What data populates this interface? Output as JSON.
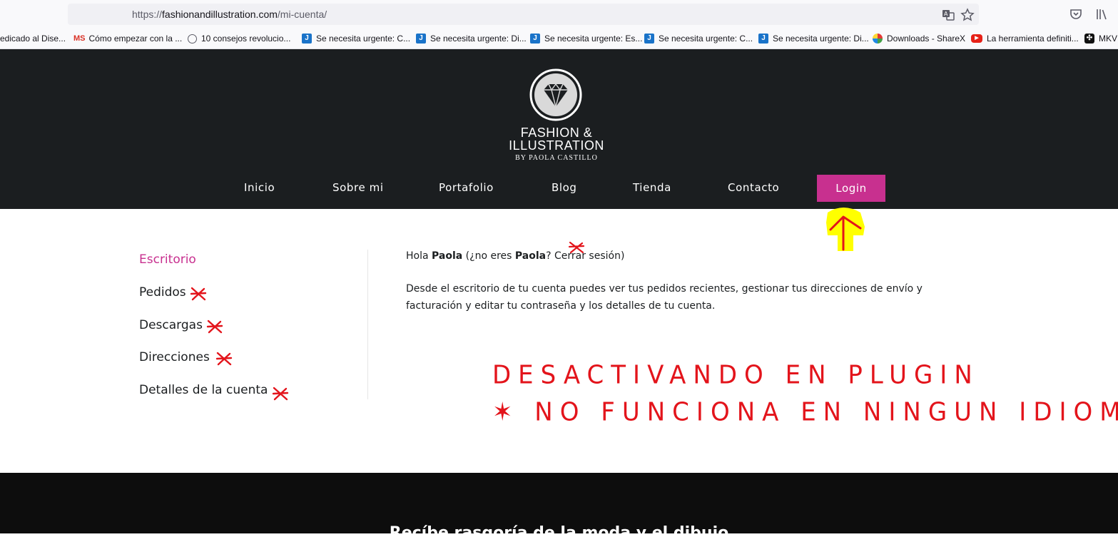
{
  "browser": {
    "url_scheme_prefix": "https://",
    "url_host": "fashionandillustration.com",
    "url_path": "/mi-cuenta/"
  },
  "bookmarks": [
    {
      "label": "edicado al Dise...",
      "icon": "none"
    },
    {
      "label": "Cómo empezar con la ...",
      "icon": "ms",
      "icon_text": "MS"
    },
    {
      "label": "10 consejos revolucio...",
      "icon": "globe"
    },
    {
      "label": "Se necesita urgente: C...",
      "icon": "j",
      "icon_text": "J"
    },
    {
      "label": "Se necesita urgente: Di...",
      "icon": "j",
      "icon_text": "J"
    },
    {
      "label": "Se necesita urgente: Es...",
      "icon": "j",
      "icon_text": "J"
    },
    {
      "label": "Se necesita urgente: C...",
      "icon": "j",
      "icon_text": "J"
    },
    {
      "label": "Se necesita urgente: Di...",
      "icon": "j",
      "icon_text": "J"
    },
    {
      "label": "Downloads - ShareX",
      "icon": "sharex"
    },
    {
      "label": "La herramienta definiti...",
      "icon": "youtube",
      "icon_text": "▶"
    },
    {
      "label": "MKV",
      "icon": "mkv",
      "icon_text": "✣"
    }
  ],
  "site": {
    "logo_line1": "FASHION &",
    "logo_line2": "ILLUSTRATION",
    "logo_sub": "BY PAOLA CASTILLO",
    "nav": [
      "Inicio",
      "Sobre mi",
      "Portafolio",
      "Blog",
      "Tienda",
      "Contacto"
    ],
    "login_label": "Login",
    "brand_color": "#c8308f",
    "header_color": "#1b1e20"
  },
  "account": {
    "nav": [
      "Escritorio",
      "Pedidos",
      "Descargas",
      "Direcciones",
      "Detalles de la cuenta"
    ],
    "greeting": {
      "hola": "Hola",
      "user": "Paola",
      "no_eres": "(¿no eres",
      "user2": "Paola",
      "q": "?",
      "logout": "Cerrar sesión",
      "close": ")"
    },
    "dashboard_text": "Desde el escritorio de tu cuenta puedes ver tus pedidos recientes, gestionar tus direcciones de envío y facturación y editar tu contraseña y los detalles de tu cuenta."
  },
  "annotations": {
    "line1": "DESACTIVANDO EN PLUGIN",
    "line2": "✶ NO FUNCIONA  EN NINGUN IDIOMA",
    "color": "#e3141b",
    "highlight_color": "#ffff00"
  },
  "footer": {
    "text": "Recíbe rasgoría de la moda y el dibujo"
  }
}
